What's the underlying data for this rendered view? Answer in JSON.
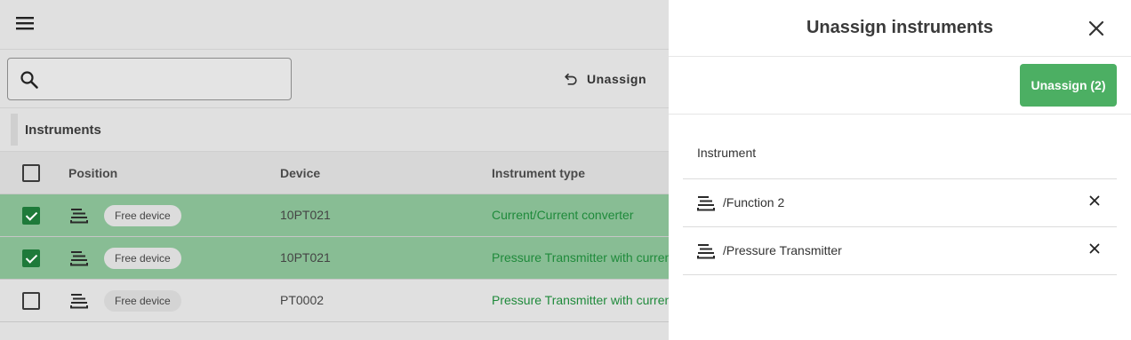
{
  "app": {
    "search": {
      "value": "",
      "placeholder": ""
    },
    "toolbar": {
      "unassign_label": "Unassign"
    },
    "section_title": "Instruments",
    "columns": {
      "position": "Position",
      "device": "Device",
      "instrument_type": "Instrument type"
    },
    "rows": [
      {
        "checked": true,
        "badge": "Free device",
        "device": "10PT021",
        "instrument_type": "Current/Current converter"
      },
      {
        "checked": true,
        "badge": "Free device",
        "device": "10PT021",
        "instrument_type": "Pressure Transmitter with current output"
      },
      {
        "checked": false,
        "badge": "Free device",
        "device": "PT0002",
        "instrument_type": "Pressure Transmitter with current output"
      }
    ],
    "colors": {
      "selected_row": "#88bd94",
      "type_text": "#1f8a3b",
      "check": "#1e7a3a"
    }
  },
  "drawer": {
    "title": "Unassign instruments",
    "action_label": "Unassign (2)",
    "list_header": "Instrument",
    "items": [
      {
        "label": "/Function 2"
      },
      {
        "label": "/Pressure Transmitter"
      }
    ],
    "colors": {
      "primary": "#4caf63"
    }
  }
}
